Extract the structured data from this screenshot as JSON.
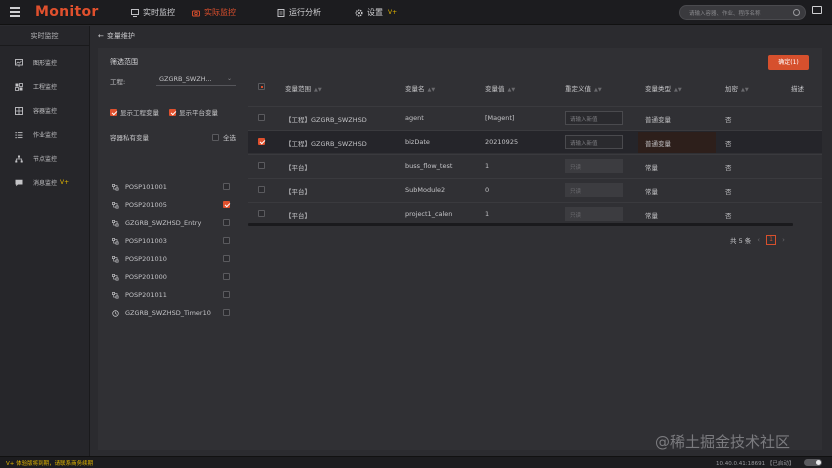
{
  "app": {
    "logo": "Monitor"
  },
  "nav": [
    {
      "label": "实时监控",
      "icon": "monitor-icon",
      "active": false,
      "vplus": ""
    },
    {
      "label": "实际监控",
      "icon": "camera-icon",
      "active": true,
      "vplus": ""
    },
    {
      "label": "运行分析",
      "icon": "doc-icon",
      "active": false,
      "vplus": ""
    },
    {
      "label": "设置",
      "icon": "gear-icon",
      "active": false,
      "vplus": "V+"
    }
  ],
  "search": {
    "placeholder": "请输入容器、作业、程序名称"
  },
  "sidebar": {
    "title": "实时监控",
    "items": [
      {
        "label": "图形监控",
        "icon": "graph-icon",
        "vplus": ""
      },
      {
        "label": "工程监控",
        "icon": "project-icon",
        "vplus": ""
      },
      {
        "label": "容器监控",
        "icon": "container-icon",
        "vplus": ""
      },
      {
        "label": "作业监控",
        "icon": "list-icon",
        "vplus": ""
      },
      {
        "label": "节点监控",
        "icon": "node-icon",
        "vplus": ""
      },
      {
        "label": "消息监控",
        "icon": "message-icon",
        "vplus": "V+"
      }
    ]
  },
  "breadcrumb": {
    "label": "变量维护"
  },
  "filter": {
    "title": "筛选范围",
    "project_label": "工程:",
    "project_value": "GZGRB_SWZH...",
    "show_project_vars": "显示工程变量",
    "show_platform_vars": "显示平台变量",
    "vars_header": "容器私有变量",
    "select_all": "全选",
    "items": [
      {
        "name": "POSP101001",
        "checked": false,
        "icon": "var-icon"
      },
      {
        "name": "POSP201005",
        "checked": true,
        "icon": "var-icon"
      },
      {
        "name": "GZGRB_SWZHSD_Entry",
        "checked": false,
        "icon": "var-icon"
      },
      {
        "name": "POSP101003",
        "checked": false,
        "icon": "var-icon"
      },
      {
        "name": "POSP201010",
        "checked": false,
        "icon": "var-icon"
      },
      {
        "name": "POSP201000",
        "checked": false,
        "icon": "var-icon"
      },
      {
        "name": "POSP201011",
        "checked": false,
        "icon": "var-icon"
      },
      {
        "name": "GZGRB_SWZHSD_Timer10",
        "checked": false,
        "icon": "clock-icon"
      }
    ]
  },
  "table": {
    "confirm_label": "确定(1)",
    "columns": [
      "变量范围",
      "变量名",
      "变量值",
      "重定义值",
      "变量类型",
      "加密",
      "描述"
    ],
    "rows": [
      {
        "scope": "【工程】GZGRB_SWZHSD",
        "name": "agent",
        "value": "[Magent]",
        "redefine": "请输入新值",
        "redefine_disabled": false,
        "type": "普通变量",
        "encrypt": "否",
        "selected": false
      },
      {
        "scope": "【工程】GZGRB_SWZHSD",
        "name": "bizDate",
        "value": "20210925",
        "redefine": "请输入新值",
        "redefine_disabled": false,
        "type": "普通变量",
        "encrypt": "否",
        "selected": true
      },
      {
        "scope": "【平台】",
        "name": "buss_flow_test",
        "value": "1",
        "redefine": "只读",
        "redefine_disabled": true,
        "type": "常量",
        "encrypt": "否",
        "selected": false
      },
      {
        "scope": "【平台】",
        "name": "SubModule2",
        "value": "0",
        "redefine": "只读",
        "redefine_disabled": true,
        "type": "常量",
        "encrypt": "否",
        "selected": false
      },
      {
        "scope": "【平台】",
        "name": "project1_calen",
        "value": "1",
        "redefine": "只读",
        "redefine_disabled": true,
        "type": "常量",
        "encrypt": "否",
        "selected": false
      }
    ],
    "pager": {
      "total": "共 5 条",
      "page": "1"
    }
  },
  "status": {
    "notice": "V+ 体验版将到期，请联系商务续期",
    "right": "10.40.0.41:18691 【已启动】"
  },
  "watermark": "@稀土掘金技术社区",
  "colors": {
    "accent": "#e0502d",
    "vplus": "#e6b800"
  }
}
